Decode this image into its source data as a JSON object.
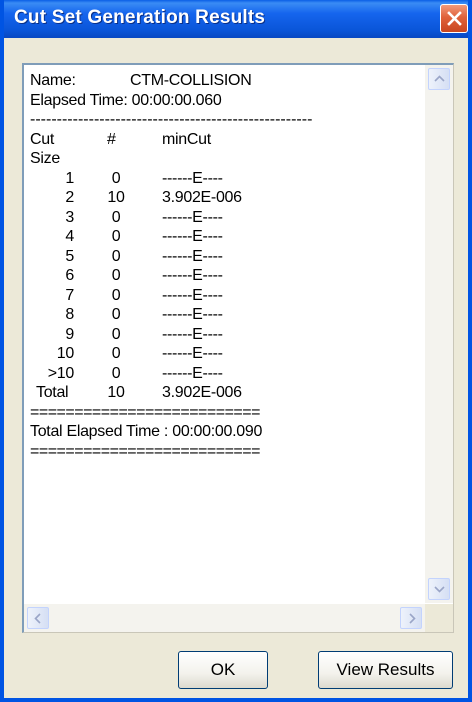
{
  "window": {
    "title": "Cut Set Generation Results"
  },
  "titlebar": {
    "close_icon": "close-x-icon"
  },
  "results": {
    "name_label": "Name:",
    "name_value": "CTM-COLLISION",
    "elapsed_line": "Elapsed Time: 00:00:00.060",
    "separator_dash": "-----------------------------------------------------",
    "headers": {
      "cut": "Cut",
      "count": "#",
      "mincut": "minCut",
      "size": "Size"
    },
    "rows": [
      {
        "size": "1",
        "count": "0",
        "mincut": "------E----"
      },
      {
        "size": "2",
        "count": "10",
        "mincut": "3.902E-006"
      },
      {
        "size": "3",
        "count": "0",
        "mincut": "------E----"
      },
      {
        "size": "4",
        "count": "0",
        "mincut": "------E----"
      },
      {
        "size": "5",
        "count": "0",
        "mincut": "------E----"
      },
      {
        "size": "6",
        "count": "0",
        "mincut": "------E----"
      },
      {
        "size": "7",
        "count": "0",
        "mincut": "------E----"
      },
      {
        "size": "8",
        "count": "0",
        "mincut": "------E----"
      },
      {
        "size": "9",
        "count": "0",
        "mincut": "------E----"
      },
      {
        "size": "10",
        "count": "0",
        "mincut": "------E----"
      },
      {
        "size": ">10",
        "count": "0",
        "mincut": "------E----"
      }
    ],
    "total": {
      "label": "Total",
      "count": "10",
      "mincut": "3.902E-006"
    },
    "separator_eq": "==========================",
    "total_elapsed_line": "Total Elapsed Time : 00:00:00.090"
  },
  "scrollbars": {
    "up_icon": "scroll-up-icon",
    "down_icon": "scroll-down-icon",
    "left_icon": "scroll-left-icon",
    "right_icon": "scroll-right-icon"
  },
  "buttons": {
    "ok_label": "OK",
    "view_results_label": "View Results"
  }
}
